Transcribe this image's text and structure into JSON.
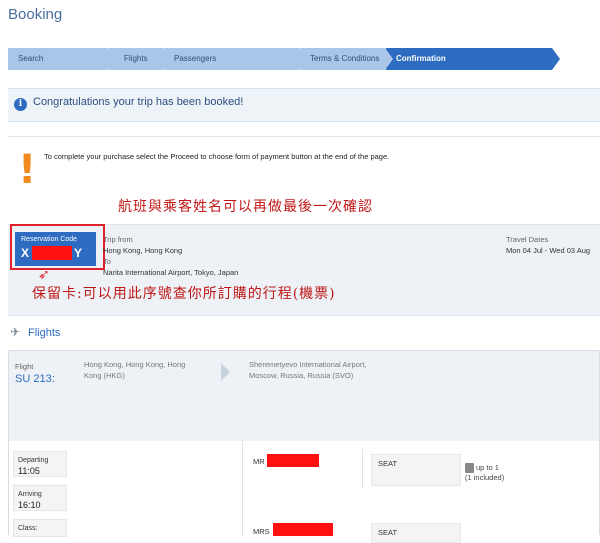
{
  "page": {
    "title": "Booking"
  },
  "steps": [
    "Search",
    "Flights",
    "Passengers",
    "Terms & Conditions",
    "Confirmation"
  ],
  "congrats": "Congratulations your trip has been booked!",
  "notice": "To complete your purchase select the Proceed to choose form of payment button at the end of the page.",
  "annotation_top": "航班與乘客姓名可以再做最後一次確認",
  "reservation": {
    "label": "Reservation Code",
    "code_start": "X",
    "code_end": "Y"
  },
  "trip": {
    "from_label": "Trip from",
    "from": "Hong Kong, Hong Kong",
    "to_label": "To",
    "to": "Narita International Airport, Tokyo, Japan"
  },
  "dates": {
    "label": "Travel Dates",
    "value": "Mon 04 Jul - Wed 03 Aug"
  },
  "annotation_arrow": "➶",
  "annotation_bottom": "保留卡:可以用此序號查你所訂購的行程(機票)",
  "flights_section": {
    "label": "Flights"
  },
  "flight": {
    "label": "Flight",
    "number": "SU 213:",
    "origin": "Hong Kong, Hong Kong, Hong Kong (HKG)",
    "destination": "Sheremetyevo International Airport, Moscow, Russia, Russia (SVO)",
    "departing_label": "Departing",
    "departing_time": "11:05",
    "arriving_label": "Arriving",
    "arriving_time": "16:10",
    "class_label": "Class:"
  },
  "passengers": [
    {
      "title": "MR",
      "seat_label": "SEAT",
      "baggage": "up to 1",
      "baggage_note": "(1 included)"
    },
    {
      "title": "MRS",
      "seat_label": "SEAT"
    }
  ],
  "colors": {
    "accent": "#2d6cc0",
    "step_inactive": "#a9c6e8",
    "annotation": "#c01818",
    "redact": "#ff1010",
    "warning": "#f08a1f"
  }
}
